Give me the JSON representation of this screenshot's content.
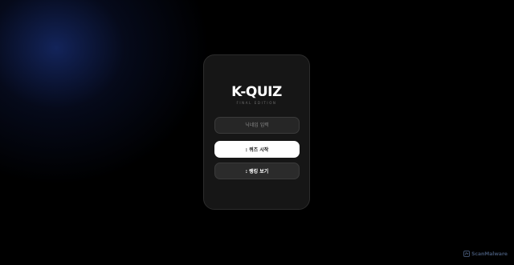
{
  "app": {
    "title": "K-QUIZ",
    "subtitle": "FINAL EDITION"
  },
  "form": {
    "nickname_placeholder": "닉네임 입력",
    "nickname_value": ""
  },
  "buttons": {
    "start_label": ": 퀴즈 시작",
    "ranking_label": ": 랭킹 보기"
  },
  "watermark": {
    "text": "ScanMalware",
    "icon": "scanmalware-logo-icon"
  },
  "colors": {
    "background": "#000000",
    "card": "#161616",
    "primary_button": "#ffffff",
    "secondary_button": "#2b2b2b",
    "glow": "#14265f"
  }
}
